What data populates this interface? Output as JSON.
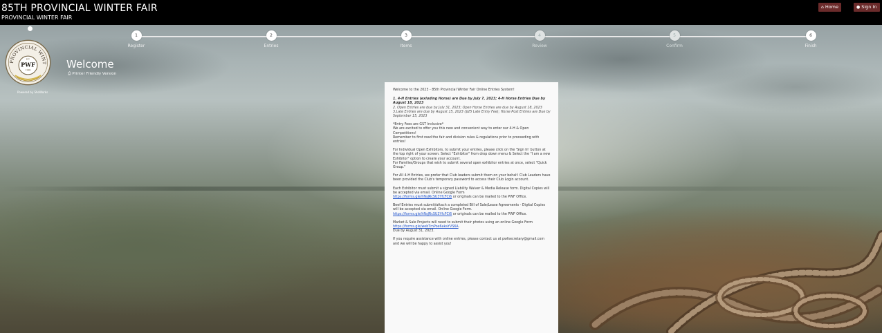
{
  "header": {
    "title": "85TH PROVINCIAL WINTER FAIR",
    "subtitle": "PROVINCIAL WINTER FAIR",
    "home_label": "Home",
    "signin_label": "Sign In",
    "home_icon": "home-icon",
    "signin_icon": "user-icon"
  },
  "steps": [
    {
      "num": "1",
      "label": "Register"
    },
    {
      "num": "2",
      "label": "Entries"
    },
    {
      "num": "3",
      "label": "Items"
    },
    {
      "num": "4",
      "label": "Review"
    },
    {
      "num": "5",
      "label": "Confirm"
    },
    {
      "num": "6",
      "label": "Finish"
    }
  ],
  "logo": {
    "top_text": "PROVINCIAL WINTER FAIR",
    "est": "EST.",
    "center": "PWF",
    "year": "1938"
  },
  "powered_by": "Powered by ShoWorks",
  "page": {
    "title": "Welcome",
    "printer_label": "Printer Friendly Version",
    "printer_icon": "print-icon"
  },
  "content": {
    "heading": "Welcome to the 2023 - 85th Provincial Winter Fair Online Entries System!",
    "d1": "1.  4-H  Entries (exluding Horse) are Due by July 7, 2023; 4-H Horse Entries Due by August 18, 2023",
    "d2": "2. Open Entries are due by July 31, 2023; Open Horse Entries are due by August 18, 2023",
    "d3": "3.Late Entries are due by August 15, 2023 ($25 Late Entry Fee); Horse Post Entries are Due by September 15, 2023",
    "gst": "*Entry Fees are GST Inclusive*",
    "excited": "We are excited to offer you this new and convenient way to enter our 4-H & Open Competitions!",
    "remember": " Remember to first read the fair and division rules & regulations prior to proceeding with entries!",
    "individual": "For Individual Open Exhibitors, to submit your entries, please click on the 'Sign In' button at the top right of your screen. Select \"Exhibitor\" from drop down menu & Select the \"I am a new Exhibitor\" option to create your account.",
    "families": "For Families/Groups that wish to submit several open exhibitor entries at once, select \"Quick Group.\"",
    "fourh": "For All 4-H Entries, we prefer that Club leaders submit them on your behalf. Club Leaders have been provided the Club's temporary password to access their Club Login account.",
    "waiver_a": "Each Exhibitor must submit a signed Liability Waiver & Media Release form. Digital Copies will be accepted via email. Online Google Form",
    "waiver_link": "https://forms.gle/hNsJRcSU3YfcFCi6",
    "waiver_b": "  or originals can be mailed to the PWF Office.",
    "beef_a": "Beef Entries must submit/attach a completed Bill of Sale/Lease Agreements - Digital Copies will be accepted via email. Online Google Form.",
    "beef_link": "https://forms.gle/hNsJRcSU3YfcFCi6",
    "beef_b": " or originals can be mailed to the PWF Office.",
    "market_a": "Market & Sale Projects will need to submit their photos using an online Google Form",
    "market_link": "https://forms.gle/webTmPoe6akaYVS6A",
    "market_b": ".",
    "market_due": "Due by August 31, 2023.",
    "assist": "If you require assistance with online entries, please contact us at pwfsecretary@gmail.com and we will be happy to assist you!"
  },
  "colors": {
    "topbar": "#000000",
    "nav_button": "#6b2b2b",
    "card": "#f9f9f9",
    "link": "#2255cc"
  }
}
